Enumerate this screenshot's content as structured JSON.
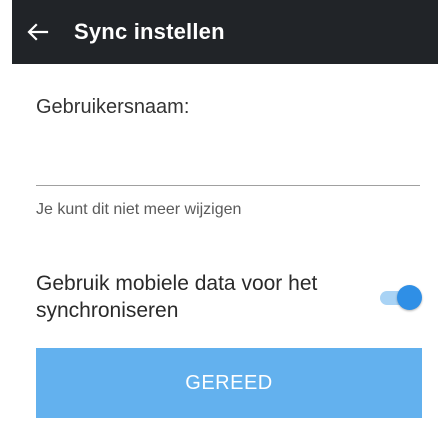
{
  "toolbar": {
    "back_icon": "arrow-left-icon",
    "title": "Sync instellen",
    "background": "#212428"
  },
  "form": {
    "username_label": "Gebruikersnaam:",
    "username_value": "",
    "helper_text": "Je kunt dit niet meer wijzigen",
    "mobile_data_label": "Gebruik mobiele data voor het synchroniseren",
    "mobile_data_enabled": true,
    "toggle_color": "#2f8fe6",
    "done_label": "GEREED",
    "done_color": "#63b1ee"
  }
}
